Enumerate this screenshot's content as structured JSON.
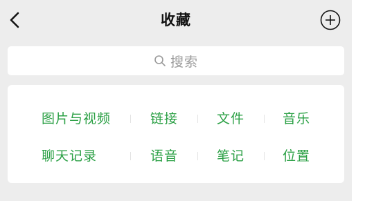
{
  "header": {
    "title": "收藏",
    "back_icon": "chevron-left-icon",
    "add_icon": "circle-plus-icon"
  },
  "search": {
    "placeholder": "搜索",
    "icon": "search-icon"
  },
  "categories": {
    "row1": [
      "图片与视频",
      "链接",
      "文件",
      "音乐"
    ],
    "row2": [
      "聊天记录",
      "语音",
      "笔记",
      "位置"
    ]
  },
  "colors": {
    "accent": "#2ba045",
    "background": "#ededed",
    "card": "#ffffff",
    "placeholder": "#9a9a9a",
    "title": "#111111"
  }
}
